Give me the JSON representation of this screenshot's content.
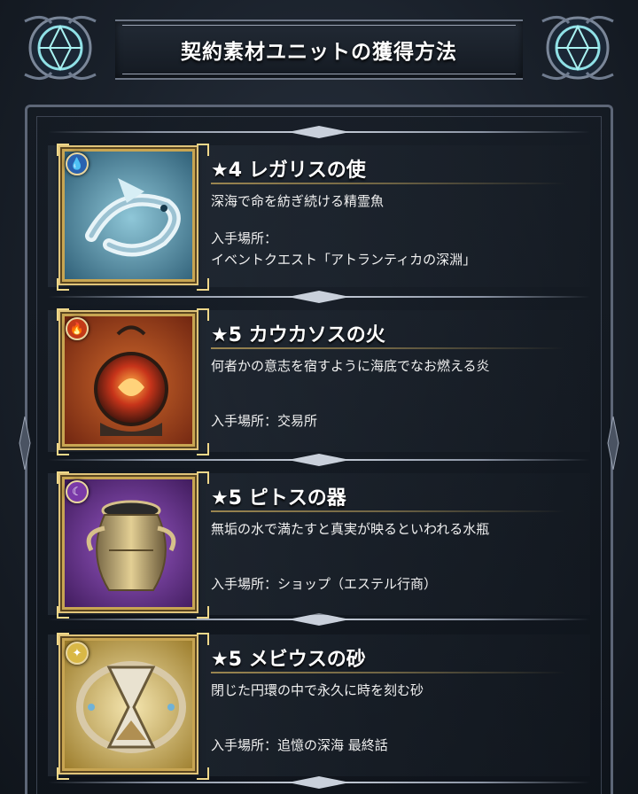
{
  "header": {
    "title": "契約素材ユニットの獲得方法"
  },
  "items": [
    {
      "name": "★4 レガリスの使",
      "description": "深海で命を紡ぎ続ける精霊魚",
      "location_label": "入手場所：",
      "location_value": "イベントクエスト「アトランティカの深淵」",
      "element_icon": "water-element-icon",
      "art_icon": "spirit-fish-icon",
      "colors": {
        "bg": "#3a6f8a",
        "accent": "#bfe6f5",
        "badge": "#2a62b0"
      }
    },
    {
      "name": "★5 カウカソスの火",
      "description": "何者かの意志を宿すように海底でなお燃える炎",
      "location_label": "",
      "location_value": "入手場所：交易所",
      "element_icon": "fire-element-icon",
      "art_icon": "flame-orb-icon",
      "colors": {
        "bg": "#a8481c",
        "accent": "#ff8a3a",
        "badge": "#c43a18"
      }
    },
    {
      "name": "★5 ピトスの器",
      "description": "無垢の水で満たすと真実が映るといわれる水瓶",
      "location_label": "",
      "location_value": "入手場所：ショップ（エステル行商）",
      "element_icon": "dark-element-icon",
      "art_icon": "jar-icon",
      "colors": {
        "bg": "#6a2f8f",
        "accent": "#c9a95a",
        "badge": "#7a3aa8"
      }
    },
    {
      "name": "★5 メビウスの砂",
      "description": "閉じた円環の中で永久に時を刻む砂",
      "location_label": "",
      "location_value": "入手場所：追憶の深海 最終話",
      "element_icon": "light-element-icon",
      "art_icon": "hourglass-icon",
      "colors": {
        "bg": "#c9a648",
        "accent": "#f3e2a8",
        "badge": "#d9b846"
      }
    }
  ]
}
